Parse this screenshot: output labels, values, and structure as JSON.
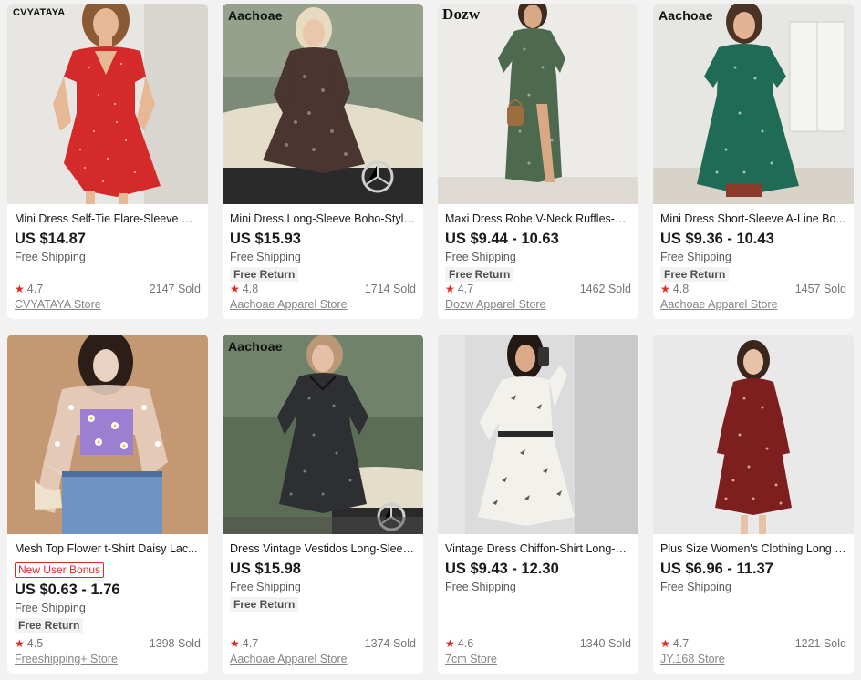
{
  "products": [
    {
      "brand_tag": "CVYATAYA",
      "title": "Mini Dress Self-Tie Flare-Sleeve Ru...",
      "price": "US $14.87",
      "shipping": "Free Shipping",
      "rating": "4.7",
      "sold": "2147 Sold",
      "store": "CVYATAYA Store",
      "colors": {
        "bg": "#e8e6e3",
        "dress": "#d42a2a",
        "skin": "#e7b895",
        "hair": "#8a5a35"
      }
    },
    {
      "brand_tag": "Aachoae",
      "title": "Mini Dress Long-Sleeve Boho-Style...",
      "price": "US $15.93",
      "shipping": "Free Shipping",
      "free_return": "Free Return",
      "rating": "4.8",
      "sold": "1714 Sold",
      "store": "Aachoae Apparel Store",
      "colors": {
        "bg": "#6e7a6a",
        "dress": "#4a3530",
        "skin": "#e9c7ad",
        "hair": "#e8dcc0"
      }
    },
    {
      "brand_tag": "Dozw",
      "title": "Maxi Dress Robe V-Neck Ruffles-W...",
      "price": "US $9.44 - 10.63",
      "shipping": "Free Shipping",
      "free_return": "Free Return",
      "rating": "4.7",
      "sold": "1462 Sold",
      "store": "Dozw Apparel Store",
      "colors": {
        "bg": "#ecebe8",
        "dress": "#4e6a4e",
        "skin": "#d9a986",
        "hair": "#3d2b20"
      }
    },
    {
      "brand_tag": "Aachoae",
      "title": "Mini Dress Short-Sleeve A-Line Bo...",
      "price": "US $9.36 - 10.43",
      "shipping": "Free Shipping",
      "free_return": "Free Return",
      "rating": "4.8",
      "sold": "1457 Sold",
      "store": "Aachoae Apparel Store",
      "colors": {
        "bg": "#e6e6e2",
        "dress": "#1f6b55",
        "skin": "#e3b393",
        "hair": "#4a3325"
      }
    },
    {
      "title": "Mesh Top Flower t-Shirt Daisy Lac...",
      "bonus": "New User Bonus",
      "price": "US $0.63 - 1.76",
      "shipping": "Free Shipping",
      "free_return": "Free Return",
      "rating": "4.5",
      "sold": "1398 Sold",
      "store": "Freeshipping+ Store",
      "colors": {
        "bg": "#c89f7a",
        "dress": "#9c7fd0",
        "skin": "#ead2c2",
        "hair": "#2b1d17"
      }
    },
    {
      "brand_tag": "Aachoae",
      "title": "Dress Vintage Vestidos Long-Sleev...",
      "price": "US $15.98",
      "shipping": "Free Shipping",
      "free_return": "Free Return",
      "rating": "4.7",
      "sold": "1374 Sold",
      "store": "Aachoae Apparel Store",
      "colors": {
        "bg": "#5c6d55",
        "dress": "#2e2f33",
        "skin": "#e6c0a6",
        "hair": "#b99876"
      }
    },
    {
      "title": "Vintage Dress Chiffon-Shirt Long-Sl...",
      "price": "US $9.43 - 12.30",
      "shipping": "Free Shipping",
      "rating": "4.6",
      "sold": "1340 Sold",
      "store": "7cm Store",
      "colors": {
        "bg": "#dcdcdc",
        "dress": "#f3f1ec",
        "skin": "#d9a98a",
        "hair": "#231914"
      }
    },
    {
      "title": "Plus Size Women's Clothing Long S...",
      "price": "US $6.96 - 11.37",
      "shipping": "Free Shipping",
      "rating": "4.7",
      "sold": "1221 Sold",
      "store": "JY.168 Store",
      "colors": {
        "bg": "#e9e9e9",
        "dress": "#7e1f1f",
        "skin": "#e8c2a6",
        "hair": "#3a261c"
      }
    }
  ]
}
